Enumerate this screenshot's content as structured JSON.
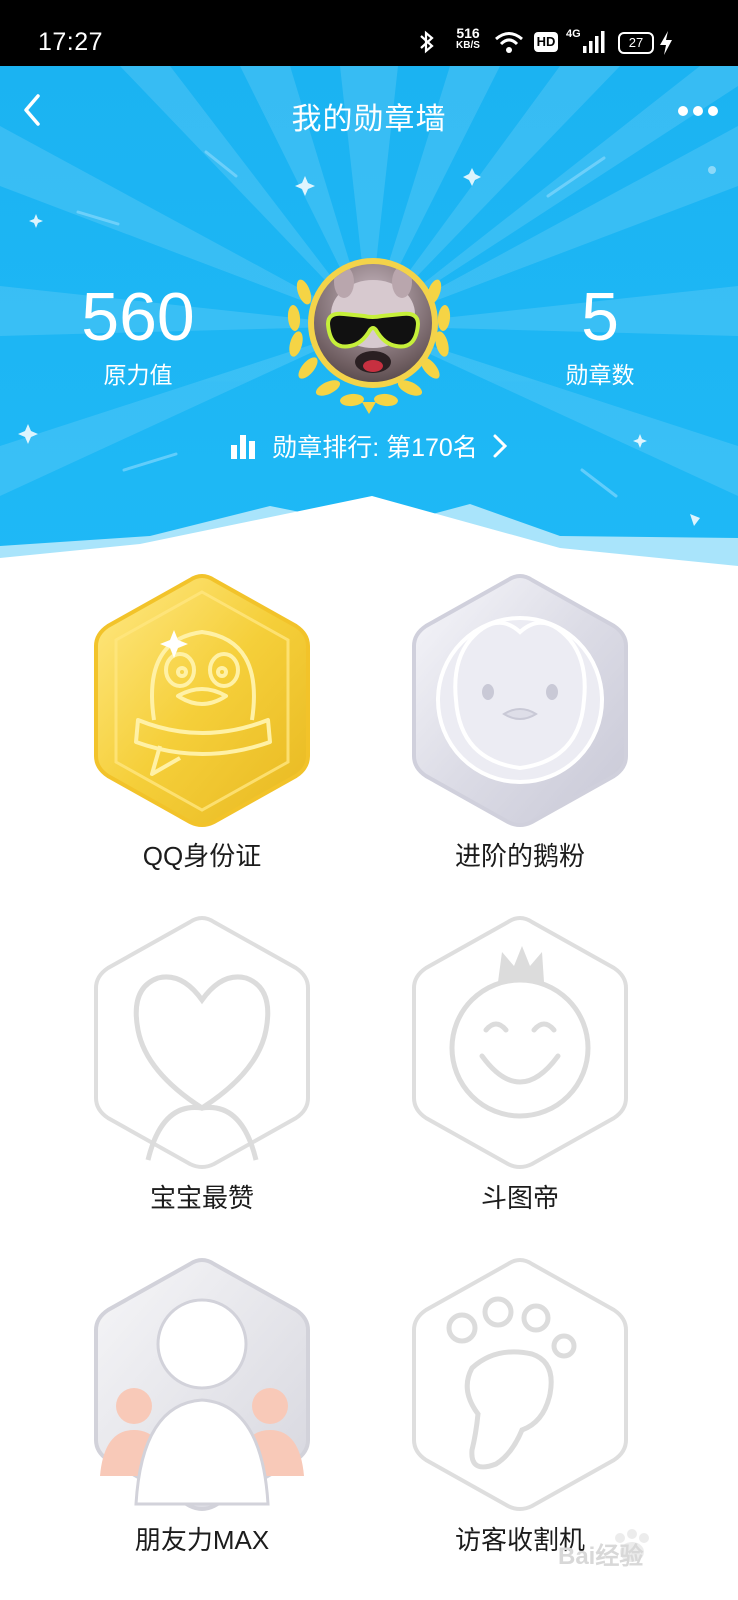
{
  "status_bar": {
    "time": "17:27",
    "net_speed_value": "516",
    "net_speed_unit": "KB/S",
    "hd": "HD",
    "network": "4G",
    "battery": "27",
    "icons": [
      "bluetooth-icon",
      "wifi-icon",
      "signal-icon",
      "battery-icon",
      "charging-icon"
    ]
  },
  "header": {
    "title": "我的勋章墙",
    "back_icon": "chevron-left-icon",
    "more_icon": "more-dots-icon"
  },
  "stats": {
    "power_value": "560",
    "power_label": "原力值",
    "medal_count": "5",
    "medal_label": "勋章数"
  },
  "rank": {
    "text": "勋章排行: 第170名",
    "icon": "bar-chart-icon",
    "arrow_icon": "chevron-right-icon"
  },
  "badges": [
    {
      "label": "QQ身份证",
      "icon": "qq-penguin-gold-badge",
      "state": "gold"
    },
    {
      "label": "进阶的鹅粉",
      "icon": "penguin-face-silver-badge",
      "state": "silver"
    },
    {
      "label": "宝宝最赞",
      "icon": "heart-badge",
      "state": "locked"
    },
    {
      "label": "斗图帝",
      "icon": "smiley-crown-badge",
      "state": "locked"
    },
    {
      "label": "朋友力MAX",
      "icon": "friends-badge",
      "state": "partial"
    },
    {
      "label": "访客收割机",
      "icon": "footprint-badge",
      "state": "locked"
    }
  ],
  "watermark": {
    "text": "Bai经验",
    "logo": "baidu-paw-icon"
  },
  "colors": {
    "hero_blue": "#1bb3f2",
    "gold": "#f3d34a",
    "locked_gray": "#dcdcdc"
  }
}
